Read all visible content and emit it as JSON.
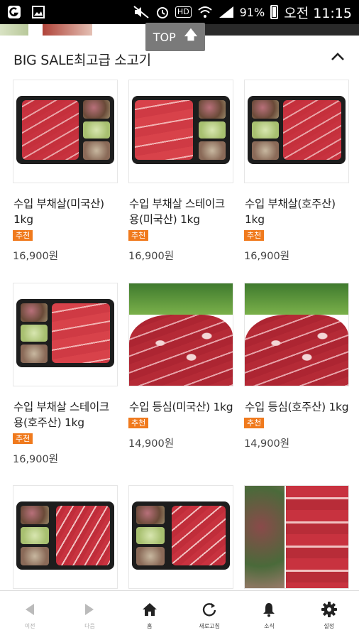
{
  "status_bar": {
    "battery": "91%",
    "time": "오전 11:15",
    "hd": "HD",
    "icons": [
      "notification-icon",
      "gallery-icon",
      "mute-icon",
      "alarm-icon",
      "hd-icon",
      "wifi-icon",
      "signal-icon",
      "battery-icon"
    ]
  },
  "top_button": {
    "label": "TOP"
  },
  "section": {
    "title": "BIG SALE최고급 소고기"
  },
  "products": [
    {
      "name": "수입 부채살(미국산) 1kg",
      "badge": "추천",
      "price": "16,900원"
    },
    {
      "name": "수입 부채살 스테이크용(미국산) 1kg",
      "badge": "추천",
      "price": "16,900원"
    },
    {
      "name": "수입 부채살(호주산) 1kg",
      "badge": "추천",
      "price": "16,900원"
    },
    {
      "name": "수입 부채살 스테이크용(호주산) 1kg",
      "badge": "추천",
      "price": "16,900원"
    },
    {
      "name": "수입 등심(미국산) 1kg",
      "badge": "추천",
      "price": "14,900원"
    },
    {
      "name": "수입 등심(호주산) 1kg",
      "badge": "추천",
      "price": "14,900원"
    }
  ],
  "bottom_nav": {
    "back": "이전",
    "forward": "다음",
    "home": "홈",
    "refresh": "새로고침",
    "news": "소식",
    "settings": "설정"
  },
  "colors": {
    "badge": "#f07a1d",
    "status_bar": "#000000",
    "top_button": "#7a7a7a"
  }
}
